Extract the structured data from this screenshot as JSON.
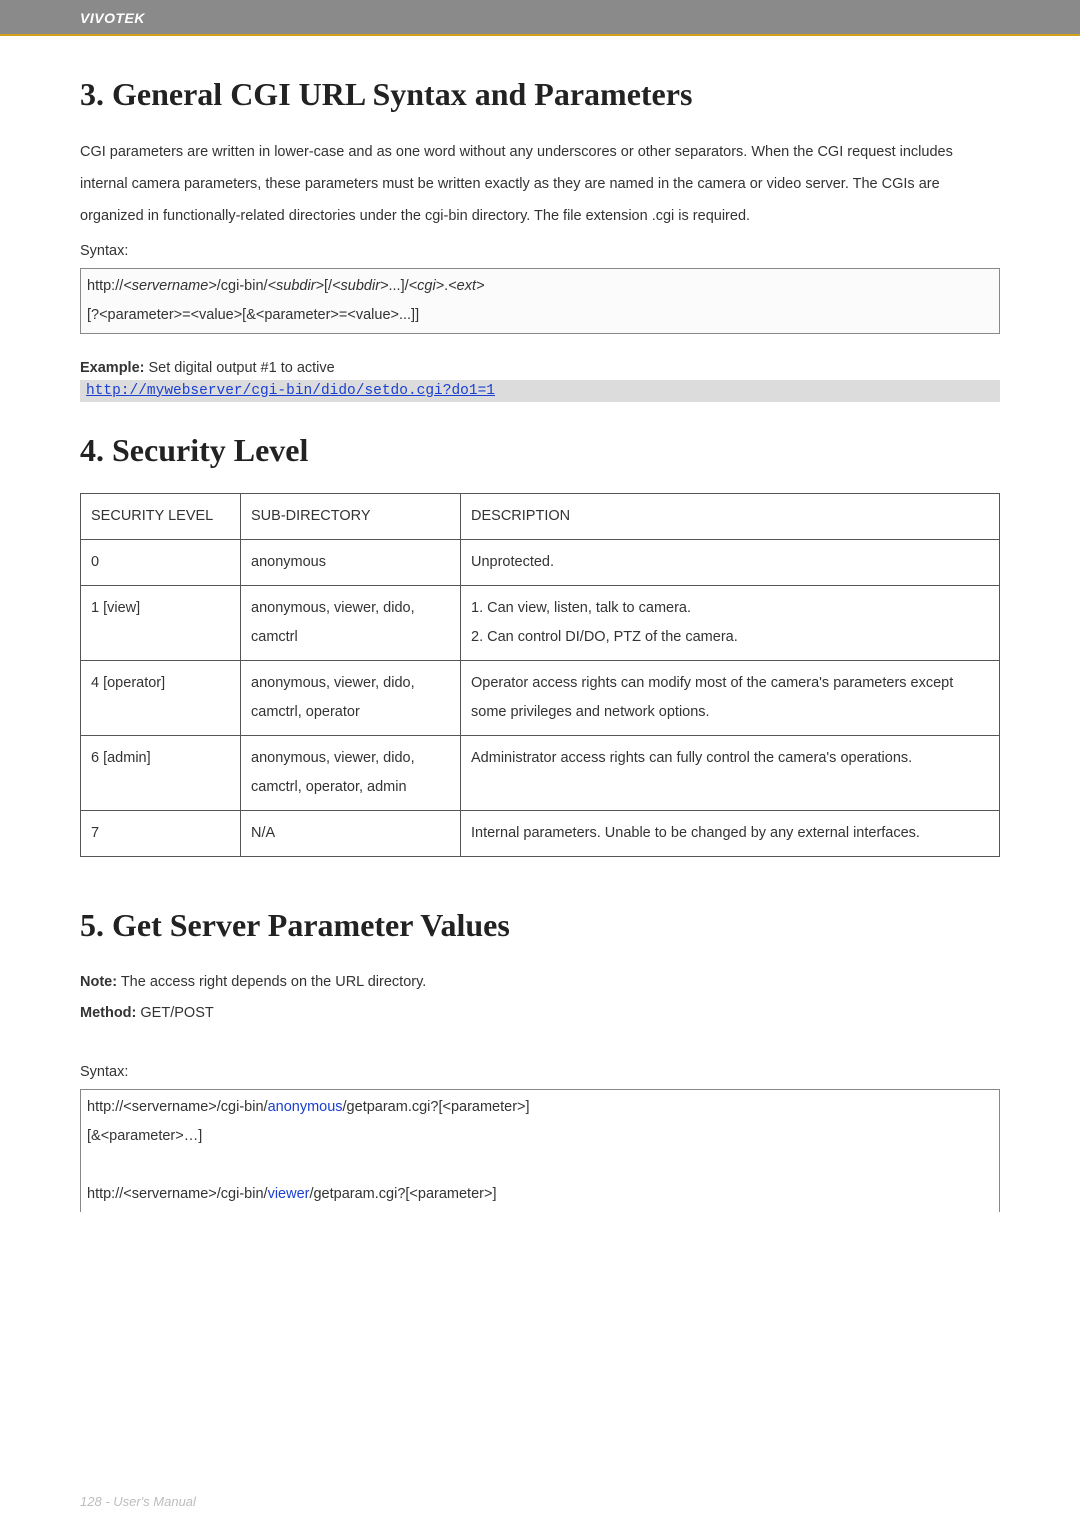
{
  "header": {
    "brand": "VIVOTEK"
  },
  "section3": {
    "title": "3. General CGI URL Syntax and Parameters",
    "para": "CGI parameters are written in lower-case and as one word without any underscores or other separators. When the CGI request includes internal camera parameters, these parameters must be written exactly as they are named in the camera or video server. The CGIs are organized in functionally-related directories under the cgi-bin directory. The file extension .cgi is required.",
    "syntax_label": "Syntax:",
    "syntax_line1_a": "http://",
    "syntax_line1_b": "<servername>",
    "syntax_line1_c": "/cgi-bin/",
    "syntax_line1_d": "<subdir>",
    "syntax_line1_e": "[/",
    "syntax_line1_f": "<subdir>",
    "syntax_line1_g": "...]/",
    "syntax_line1_h": "<cgi>",
    "syntax_line1_i": ".",
    "syntax_line1_j": "<ext>",
    "syntax_line2": "[?<parameter>=<value>[&<parameter>=<value>...]]",
    "example_label": "Example:",
    "example_text": " Set digital output #1 to active",
    "example_url": "http://mywebserver/cgi-bin/dido/setdo.cgi?do1=1"
  },
  "section4": {
    "title": "4. Security Level",
    "headers": [
      "SECURITY LEVEL",
      "SUB-DIRECTORY",
      "DESCRIPTION"
    ],
    "rows": [
      {
        "level": "0",
        "subdir": "anonymous",
        "desc": "Unprotected."
      },
      {
        "level": "1 [view]",
        "subdir": "anonymous, viewer, dido, camctrl",
        "desc": "1. Can view, listen, talk to camera.\n2. Can control DI/DO, PTZ of the camera."
      },
      {
        "level": "4 [operator]",
        "subdir": "anonymous, viewer, dido, camctrl, operator",
        "desc": "Operator access rights can modify most of the camera's parameters except some privileges and network options."
      },
      {
        "level": "6 [admin]",
        "subdir": "anonymous, viewer, dido, camctrl, operator, admin",
        "desc": "Administrator access rights can fully control the camera's operations."
      },
      {
        "level": "7",
        "subdir": "N/A",
        "desc": "Internal parameters. Unable to be changed by any external interfaces."
      }
    ]
  },
  "section5": {
    "title": "5. Get Server Parameter Values",
    "note_label": "Note:",
    "note_text": " The access right depends on the URL directory.",
    "method_label": "Method:",
    "method_text": " GET/POST",
    "syntax_label": "Syntax:",
    "s1_a": "http://",
    "s1_b": "<servername>",
    "s1_c": "/cgi-bin/",
    "s1_d": "anonymous",
    "s1_e": "/getparam.cgi?[",
    "s1_f": "<parameter>",
    "s1_g": "]",
    "s1_line2": "[&<parameter>…]",
    "s2_a": "http://",
    "s2_b": "<servername>",
    "s2_c": "/cgi-bin/",
    "s2_d": "viewer",
    "s2_e": "/getparam.cgi?[",
    "s2_f": "<parameter>",
    "s2_g": "]"
  },
  "footer": {
    "text": "128 - User's Manual"
  }
}
